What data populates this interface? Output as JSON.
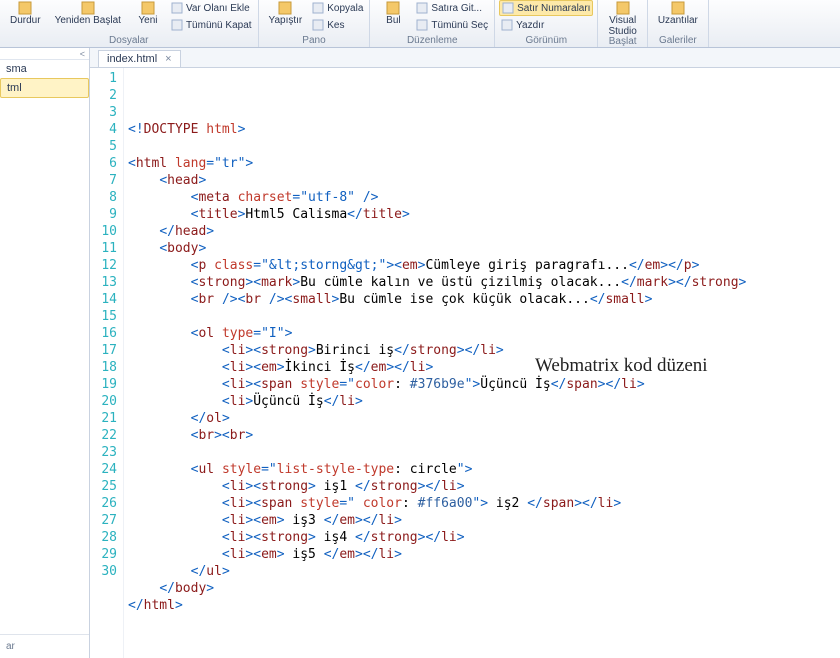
{
  "ribbon": {
    "groups": [
      {
        "label": "Dosyalar",
        "big": [
          {
            "name": "durdur",
            "label": "Durdur"
          },
          {
            "name": "restart",
            "label": "Yeniden Başlat"
          },
          {
            "name": "new",
            "label": "Yeni"
          }
        ],
        "small": [
          {
            "name": "varolani",
            "label": "Var Olanı Ekle"
          },
          {
            "name": "tumkapat",
            "label": "Tümünü Kapat"
          }
        ]
      },
      {
        "label": "Pano",
        "big": [
          {
            "name": "paste",
            "label": "Yapıştır"
          }
        ],
        "small": [
          {
            "name": "copy",
            "label": "Kopyala"
          },
          {
            "name": "cut",
            "label": "Kes"
          }
        ]
      },
      {
        "label": "Düzenleme",
        "big": [
          {
            "name": "find",
            "label": "Bul"
          }
        ],
        "small": [
          {
            "name": "goto",
            "label": "Satıra Git..."
          },
          {
            "name": "selectall",
            "label": "Tümünü Seç"
          }
        ]
      },
      {
        "label": "Görünüm",
        "big": [],
        "small": [
          {
            "name": "linenumbers",
            "label": "Satır Numaraları",
            "hl": true
          },
          {
            "name": "print",
            "label": "Yazdır"
          }
        ]
      },
      {
        "label": "Başlat",
        "big": [
          {
            "name": "vs",
            "label": "Visual\nStudio"
          }
        ],
        "small": []
      },
      {
        "label": "Galeriler",
        "big": [
          {
            "name": "ext",
            "label": "Uzantılar"
          }
        ],
        "small": []
      }
    ]
  },
  "sidebar": {
    "items": [
      "sma",
      "tml"
    ],
    "selected_index": 1,
    "footer": "ar"
  },
  "tab": {
    "name": "index.html"
  },
  "overlay": "Webmatrix kod düzeni",
  "code": {
    "lines": [
      [
        [
          "ang",
          "<!"
        ],
        [
          "tag",
          "DOCTYPE "
        ],
        [
          "attr",
          "html"
        ],
        [
          "ang",
          ">"
        ]
      ],
      [],
      [
        [
          "ang",
          "<"
        ],
        [
          "tag",
          "html "
        ],
        [
          "attr",
          "lang"
        ],
        [
          "ang",
          "="
        ],
        [
          "val",
          "\"tr\""
        ],
        [
          "ang",
          ">"
        ]
      ],
      [
        [
          "sp",
          "    "
        ],
        [
          "ang",
          "<"
        ],
        [
          "tag",
          "head"
        ],
        [
          "ang",
          ">"
        ]
      ],
      [
        [
          "sp",
          "        "
        ],
        [
          "ang",
          "<"
        ],
        [
          "tag",
          "meta "
        ],
        [
          "attr",
          "charset"
        ],
        [
          "ang",
          "="
        ],
        [
          "val",
          "\"utf-8\""
        ],
        [
          "ang",
          " />"
        ]
      ],
      [
        [
          "sp",
          "        "
        ],
        [
          "ang",
          "<"
        ],
        [
          "tag",
          "title"
        ],
        [
          "ang",
          ">"
        ],
        [
          "txt",
          "Html5 Calisma"
        ],
        [
          "ang",
          "</"
        ],
        [
          "tag",
          "title"
        ],
        [
          "ang",
          ">"
        ]
      ],
      [
        [
          "sp",
          "    "
        ],
        [
          "ang",
          "</"
        ],
        [
          "tag",
          "head"
        ],
        [
          "ang",
          ">"
        ]
      ],
      [
        [
          "sp",
          "    "
        ],
        [
          "ang",
          "<"
        ],
        [
          "tag",
          "body"
        ],
        [
          "ang",
          ">"
        ]
      ],
      [
        [
          "sp",
          "        "
        ],
        [
          "ang",
          "<"
        ],
        [
          "tag",
          "p "
        ],
        [
          "attr",
          "class"
        ],
        [
          "ang",
          "="
        ],
        [
          "val",
          "\"&lt;storng&gt;\""
        ],
        [
          "ang",
          "><"
        ],
        [
          "tag",
          "em"
        ],
        [
          "ang",
          ">"
        ],
        [
          "txt",
          "Cümleye giriş paragrafı..."
        ],
        [
          "ang",
          "</"
        ],
        [
          "tag",
          "em"
        ],
        [
          "ang",
          "></"
        ],
        [
          "tag",
          "p"
        ],
        [
          "ang",
          ">"
        ]
      ],
      [
        [
          "sp",
          "        "
        ],
        [
          "ang",
          "<"
        ],
        [
          "tag",
          "strong"
        ],
        [
          "ang",
          "><"
        ],
        [
          "tag",
          "mark"
        ],
        [
          "ang",
          ">"
        ],
        [
          "txt",
          "Bu cümle kalın ve üstü çizilmiş olacak..."
        ],
        [
          "ang",
          "</"
        ],
        [
          "tag",
          "mark"
        ],
        [
          "ang",
          "></"
        ],
        [
          "tag",
          "strong"
        ],
        [
          "ang",
          ">"
        ]
      ],
      [
        [
          "sp",
          "        "
        ],
        [
          "ang",
          "<"
        ],
        [
          "tag",
          "br "
        ],
        [
          "ang",
          "/><"
        ],
        [
          "tag",
          "br "
        ],
        [
          "ang",
          "/><"
        ],
        [
          "tag",
          "small"
        ],
        [
          "ang",
          ">"
        ],
        [
          "txt",
          "Bu cümle ise çok küçük olacak..."
        ],
        [
          "ang",
          "</"
        ],
        [
          "tag",
          "small"
        ],
        [
          "ang",
          ">"
        ]
      ],
      [],
      [
        [
          "sp",
          "        "
        ],
        [
          "ang",
          "<"
        ],
        [
          "tag",
          "ol "
        ],
        [
          "attr",
          "type"
        ],
        [
          "ang",
          "="
        ],
        [
          "val",
          "\"I\""
        ],
        [
          "ang",
          ">"
        ]
      ],
      [
        [
          "sp",
          "            "
        ],
        [
          "ang",
          "<"
        ],
        [
          "tag",
          "li"
        ],
        [
          "ang",
          "><"
        ],
        [
          "tag",
          "strong"
        ],
        [
          "ang",
          ">"
        ],
        [
          "txt",
          "Birinci iş"
        ],
        [
          "ang",
          "</"
        ],
        [
          "tag",
          "strong"
        ],
        [
          "ang",
          "></"
        ],
        [
          "tag",
          "li"
        ],
        [
          "ang",
          ">"
        ]
      ],
      [
        [
          "sp",
          "            "
        ],
        [
          "ang",
          "<"
        ],
        [
          "tag",
          "li"
        ],
        [
          "ang",
          "><"
        ],
        [
          "tag",
          "em"
        ],
        [
          "ang",
          ">"
        ],
        [
          "txt",
          "İkinci İş"
        ],
        [
          "ang",
          "</"
        ],
        [
          "tag",
          "em"
        ],
        [
          "ang",
          "></"
        ],
        [
          "tag",
          "li"
        ],
        [
          "ang",
          ">"
        ]
      ],
      [
        [
          "sp",
          "            "
        ],
        [
          "ang",
          "<"
        ],
        [
          "tag",
          "li"
        ],
        [
          "ang",
          "><"
        ],
        [
          "tag",
          "span "
        ],
        [
          "attr",
          "style"
        ],
        [
          "ang",
          "="
        ],
        [
          "val",
          "\""
        ],
        [
          "css",
          "color"
        ],
        [
          "txt",
          ": "
        ],
        [
          "hex",
          "#376b9e"
        ],
        [
          "val",
          "\""
        ],
        [
          "ang",
          ">"
        ],
        [
          "txt",
          "Üçüncü İş"
        ],
        [
          "ang",
          "</"
        ],
        [
          "tag",
          "span"
        ],
        [
          "ang",
          "></"
        ],
        [
          "tag",
          "li"
        ],
        [
          "ang",
          ">"
        ]
      ],
      [
        [
          "sp",
          "            "
        ],
        [
          "ang",
          "<"
        ],
        [
          "tag",
          "li"
        ],
        [
          "ang",
          ">"
        ],
        [
          "txt",
          "Üçüncü İş"
        ],
        [
          "ang",
          "</"
        ],
        [
          "tag",
          "li"
        ],
        [
          "ang",
          ">"
        ]
      ],
      [
        [
          "sp",
          "        "
        ],
        [
          "ang",
          "</"
        ],
        [
          "tag",
          "ol"
        ],
        [
          "ang",
          ">"
        ]
      ],
      [
        [
          "sp",
          "        "
        ],
        [
          "ang",
          "<"
        ],
        [
          "tag",
          "br"
        ],
        [
          "ang",
          "><"
        ],
        [
          "tag",
          "br"
        ],
        [
          "ang",
          ">"
        ]
      ],
      [],
      [
        [
          "sp",
          "        "
        ],
        [
          "ang",
          "<"
        ],
        [
          "tag",
          "ul "
        ],
        [
          "attr",
          "style"
        ],
        [
          "ang",
          "="
        ],
        [
          "val",
          "\""
        ],
        [
          "css",
          "list-style-type"
        ],
        [
          "txt",
          ": "
        ],
        [
          "txt",
          "circle"
        ],
        [
          "val",
          "\""
        ],
        [
          "ang",
          ">"
        ]
      ],
      [
        [
          "sp",
          "            "
        ],
        [
          "ang",
          "<"
        ],
        [
          "tag",
          "li"
        ],
        [
          "ang",
          "><"
        ],
        [
          "tag",
          "strong"
        ],
        [
          "ang",
          ">"
        ],
        [
          "txt",
          " iş1 "
        ],
        [
          "ang",
          "</"
        ],
        [
          "tag",
          "strong"
        ],
        [
          "ang",
          "></"
        ],
        [
          "tag",
          "li"
        ],
        [
          "ang",
          ">"
        ]
      ],
      [
        [
          "sp",
          "            "
        ],
        [
          "ang",
          "<"
        ],
        [
          "tag",
          "li"
        ],
        [
          "ang",
          "><"
        ],
        [
          "tag",
          "span "
        ],
        [
          "attr",
          "style"
        ],
        [
          "ang",
          "="
        ],
        [
          "val",
          "\" "
        ],
        [
          "css",
          "color"
        ],
        [
          "txt",
          ": "
        ],
        [
          "hex",
          "#ff6a00"
        ],
        [
          "val",
          "\""
        ],
        [
          "ang",
          ">"
        ],
        [
          "txt",
          " iş2 "
        ],
        [
          "ang",
          "</"
        ],
        [
          "tag",
          "span"
        ],
        [
          "ang",
          "></"
        ],
        [
          "tag",
          "li"
        ],
        [
          "ang",
          ">"
        ]
      ],
      [
        [
          "sp",
          "            "
        ],
        [
          "ang",
          "<"
        ],
        [
          "tag",
          "li"
        ],
        [
          "ang",
          "><"
        ],
        [
          "tag",
          "em"
        ],
        [
          "ang",
          ">"
        ],
        [
          "txt",
          " iş3 "
        ],
        [
          "ang",
          "</"
        ],
        [
          "tag",
          "em"
        ],
        [
          "ang",
          "></"
        ],
        [
          "tag",
          "li"
        ],
        [
          "ang",
          ">"
        ]
      ],
      [
        [
          "sp",
          "            "
        ],
        [
          "ang",
          "<"
        ],
        [
          "tag",
          "li"
        ],
        [
          "ang",
          "><"
        ],
        [
          "tag",
          "strong"
        ],
        [
          "ang",
          ">"
        ],
        [
          "txt",
          " iş4 "
        ],
        [
          "ang",
          "</"
        ],
        [
          "tag",
          "strong"
        ],
        [
          "ang",
          "></"
        ],
        [
          "tag",
          "li"
        ],
        [
          "ang",
          ">"
        ]
      ],
      [
        [
          "sp",
          "            "
        ],
        [
          "ang",
          "<"
        ],
        [
          "tag",
          "li"
        ],
        [
          "ang",
          "><"
        ],
        [
          "tag",
          "em"
        ],
        [
          "ang",
          ">"
        ],
        [
          "txt",
          " iş5 "
        ],
        [
          "ang",
          "</"
        ],
        [
          "tag",
          "em"
        ],
        [
          "ang",
          "></"
        ],
        [
          "tag",
          "li"
        ],
        [
          "ang",
          ">"
        ]
      ],
      [
        [
          "sp",
          "        "
        ],
        [
          "ang",
          "</"
        ],
        [
          "tag",
          "ul"
        ],
        [
          "ang",
          ">"
        ]
      ],
      [
        [
          "sp",
          "    "
        ],
        [
          "ang",
          "</"
        ],
        [
          "tag",
          "body"
        ],
        [
          "ang",
          ">"
        ]
      ],
      [
        [
          "ang",
          "</"
        ],
        [
          "tag",
          "html"
        ],
        [
          "ang",
          ">"
        ]
      ],
      []
    ]
  }
}
